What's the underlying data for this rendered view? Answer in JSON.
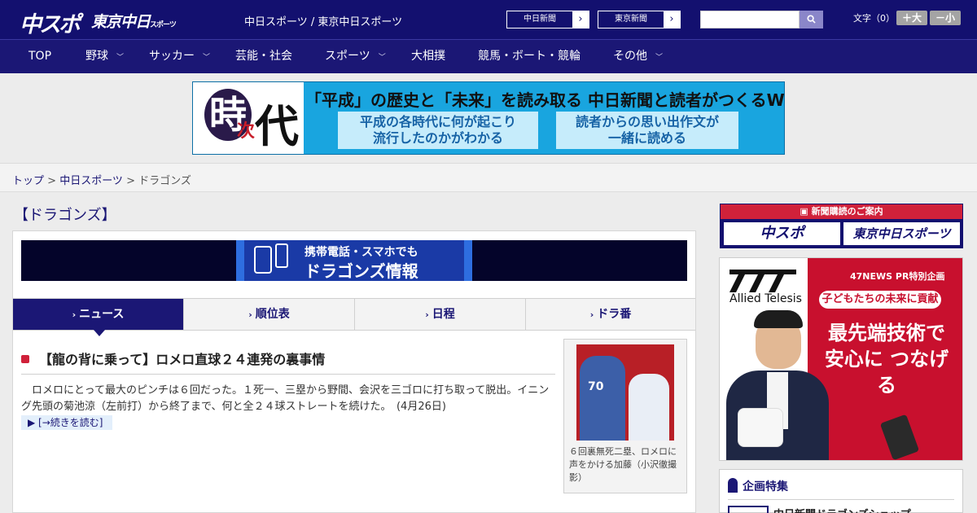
{
  "header": {
    "logo_main": "中スポ",
    "logo_tokyo": "東京中日",
    "logo_tokyo_small": "スポーツ",
    "site_title": "中日スポーツ / 東京中日スポーツ",
    "ext_links": [
      {
        "label": "中日新聞"
      },
      {
        "label": "東京新聞"
      }
    ],
    "search": {
      "placeholder": ""
    },
    "fontsize_label": "文字（0）",
    "fontsize_larger": "＋大",
    "fontsize_smaller": "－小"
  },
  "nav": {
    "items": [
      {
        "label": "TOP",
        "has_menu": false
      },
      {
        "label": "野球",
        "has_menu": true
      },
      {
        "label": "サッカー",
        "has_menu": true
      },
      {
        "label": "芸能・社会",
        "has_menu": false
      },
      {
        "label": "スポーツ",
        "has_menu": true
      },
      {
        "label": "大相撲",
        "has_menu": false
      },
      {
        "label": "競馬・ボート・競輪",
        "has_menu": false
      },
      {
        "label": "その他",
        "has_menu": true
      }
    ],
    "chevron_glyph": "﹀"
  },
  "banner": {
    "ji": "時",
    "tsugi": "次",
    "dai": "代",
    "headline": "「平成」の歴史と「未来」を読み取る 中日新聞と読者がつくるWebサイト",
    "sub_left": [
      "平成の各時代に何が起こり",
      "流行したのかがわかる"
    ],
    "sub_right": [
      "読者からの思い出作文が",
      "一緒に読める"
    ]
  },
  "breadcrumb": {
    "home": "トップ",
    "parent": "中日スポーツ",
    "current": "ドラゴンズ",
    "separator": " > "
  },
  "main": {
    "section_title": "【ドラゴンズ】",
    "mobile_banner": {
      "line1": "携帯電話・スマホでも",
      "line2": "ドラゴンズ情報"
    },
    "tabs": [
      {
        "label": "ニュース",
        "active": true
      },
      {
        "label": "順位表",
        "active": false
      },
      {
        "label": "日程",
        "active": false
      },
      {
        "label": "ドラ番",
        "active": false
      }
    ],
    "article": {
      "title": "【龍の背に乗って】ロメロ直球２４連発の裏事情",
      "body": "ロメロにとって最大のピンチは６回だった。１死一、三塁から野間、会沢を三ゴロに打ち取って脱出。イニング先頭の菊池涼（左前打）から終了まで、何と全２４球ストレートを続けた。　(4月26日)",
      "more": "▶ [→続きを読む]",
      "photo_number": "70",
      "caption": "６回裏無死二塁、ロメロに声をかける加藤（小沢徹撮影）"
    }
  },
  "sidebar": {
    "subscription": {
      "bar": "新聞購読のご案内",
      "left": "中スポ",
      "right": "東京中日スポーツ"
    },
    "ad": {
      "brand": "Allied Telesis",
      "pr": "47NEWS PR特別企画",
      "pill": "子どもたちの未来に貢献",
      "headline": "最先端技術で 安心に つなげる"
    },
    "feature": {
      "title": "企画特集",
      "item": "中日新聞ドラゴンズショップ"
    }
  },
  "colors": {
    "header_navy": "#13106f",
    "accent_red": "#d0213a",
    "banner_blue": "#19a5df"
  }
}
